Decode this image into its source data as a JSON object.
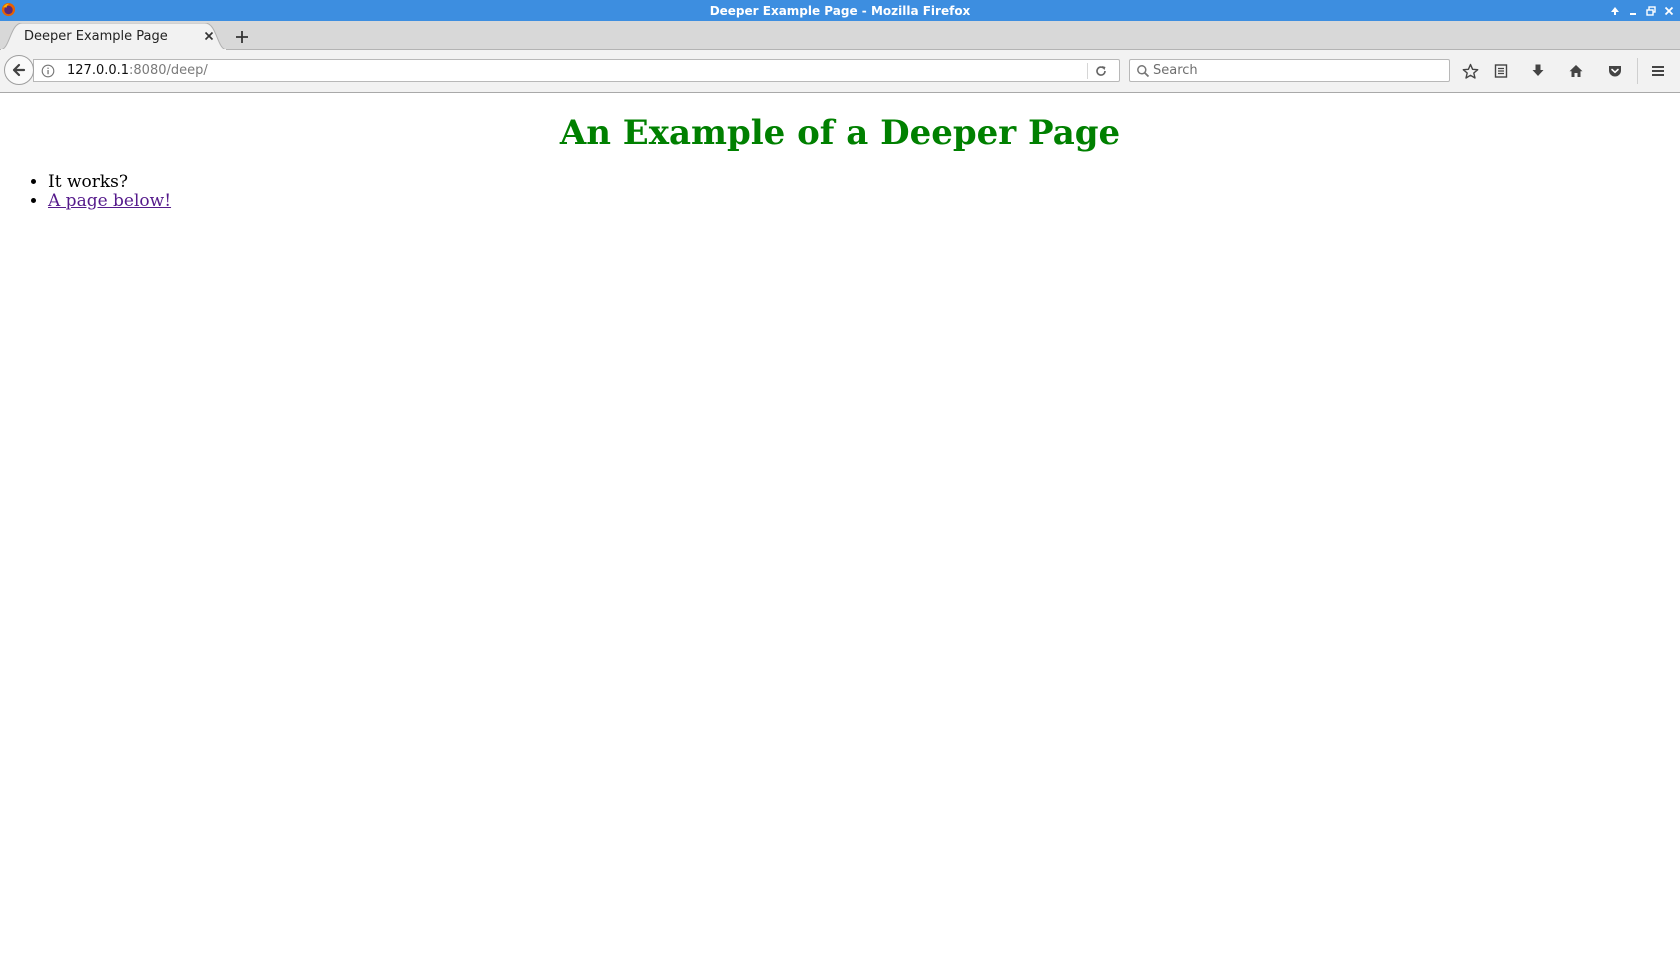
{
  "window": {
    "title": "Deeper Example Page - Mozilla Firefox",
    "app_icon": "firefox-icon",
    "controls": [
      "maximize-up-icon",
      "minimize-icon",
      "restore-icon",
      "close-icon"
    ]
  },
  "tabs": [
    {
      "label": "Deeper Example Page",
      "active": true
    }
  ],
  "navbar": {
    "url_host": "127.0.0.1",
    "url_rest": ":8080/deep/",
    "search_placeholder": "Search",
    "toolbar_icons": [
      "bookmark-star-icon",
      "reading-list-icon",
      "download-icon",
      "home-icon",
      "pocket-icon",
      "menu-icon"
    ]
  },
  "page": {
    "heading": "An Example of a Deeper Page",
    "list": {
      "item1": "It works?",
      "link_label": "A page below!"
    }
  },
  "colors": {
    "titlebar": "#3d8ee0",
    "heading": "#008000",
    "visited_link": "#551a8b"
  }
}
